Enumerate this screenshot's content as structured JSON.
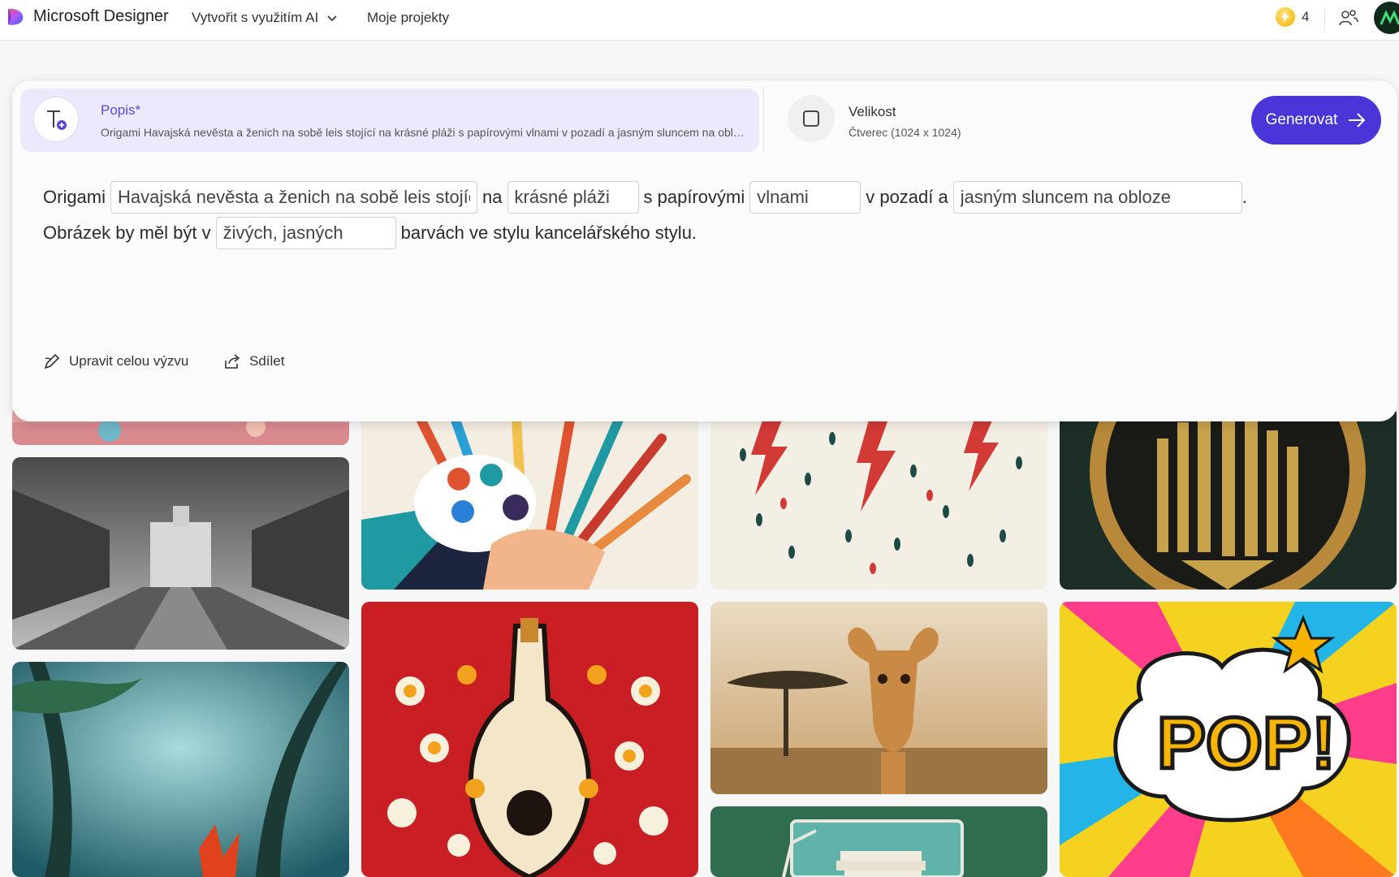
{
  "header": {
    "app_title": "Microsoft Designer",
    "nav_create": "Vytvořit s využitím AI",
    "nav_projects": "Moje projekty",
    "credits": "4"
  },
  "prompt": {
    "desc_label": "Popis*",
    "desc_text": "Origami Havajská nevěsta a ženich na sobě leis stojící na krásné pláži s papírovými vlnami v pozadí a jasným sluncem na obloze. Obrázek by měl být v živých, jasných barvách ve stylu kancelářského stylu.",
    "size_label": "Velikost",
    "size_value": "Čtverec (1024 x 1024)",
    "generate_label": "Generovat",
    "line1": {
      "w1": "Origami",
      "f1": "Havajská nevěsta a ženich na sobě leis stojící",
      "w2": "na",
      "f2": "krásné pláži",
      "w3": "s papírovými",
      "f3": "vlnami",
      "w4": "v pozadí a",
      "f4": "jasným sluncem na obloze",
      "w5": "."
    },
    "line2": {
      "w1": "Obrázek by měl být v",
      "f1": "živých, jasných",
      "w2": "barvách ve stylu kancelářského stylu."
    },
    "edit_label": "Upravit celou výzvu",
    "share_label": "Sdílet"
  },
  "colors": {
    "accent": "#4a35d8",
    "desc_bg": "#ede8fc"
  }
}
